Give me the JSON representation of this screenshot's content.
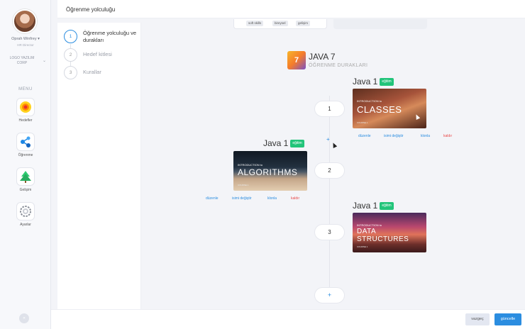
{
  "user": {
    "name": "Oprah Winfrey",
    "role": "HR Director"
  },
  "company": {
    "name": "LOGO YAZILIM CORP"
  },
  "menu": {
    "label": "MENU",
    "items": [
      {
        "label": "Hedefler",
        "icon": "target-icon"
      },
      {
        "label": "Öğrenme",
        "icon": "nodes-icon"
      },
      {
        "label": "Gelişim",
        "icon": "tree-icon"
      },
      {
        "label": "Ayarlar",
        "icon": "settings-icon"
      }
    ]
  },
  "page": {
    "title": "Öğrenme yolculuğu"
  },
  "steps": [
    {
      "num": "1",
      "label": "Öğrenme yolculuğu ve durakları",
      "active": true
    },
    {
      "num": "2",
      "label": "Hedef kitlesi",
      "active": false
    },
    {
      "num": "3",
      "label": "Kurallar",
      "active": false
    }
  ],
  "tags": [
    "soft skills",
    "bireysel",
    "gelişim"
  ],
  "journey": {
    "logo": "7",
    "title": "JAVA 7",
    "subtitle": "ÖĞRENME DURAKLARI"
  },
  "nodes": [
    "1",
    "2",
    "3",
    "+"
  ],
  "courses": [
    {
      "title": "Java 1",
      "badge": "eğitim",
      "intro": "INTRODUCTION to",
      "name": "CLASSES",
      "small": "COURSE 1"
    },
    {
      "title": "Java 1",
      "badge": "eğitim",
      "intro": "INTRODUCTION to",
      "name": "ALGORITHMS",
      "small": "COURSE 1"
    },
    {
      "title": "Java 1",
      "badge": "eğitim",
      "intro": "INTRODUCTION to",
      "name1": "DATA",
      "name2": "STRUCTURES",
      "small": "COURSE 1"
    }
  ],
  "actions": {
    "edit": "düzenle",
    "rename": "isimi değiştir",
    "clone": "klonla",
    "remove": "kaldır"
  },
  "footer": {
    "cancel": "vazgeç",
    "update": "güncelle"
  },
  "collapse_icon": "«",
  "colors": {
    "accent": "#2b8de0",
    "badge": "#22c47a",
    "danger": "#e94b4b"
  }
}
